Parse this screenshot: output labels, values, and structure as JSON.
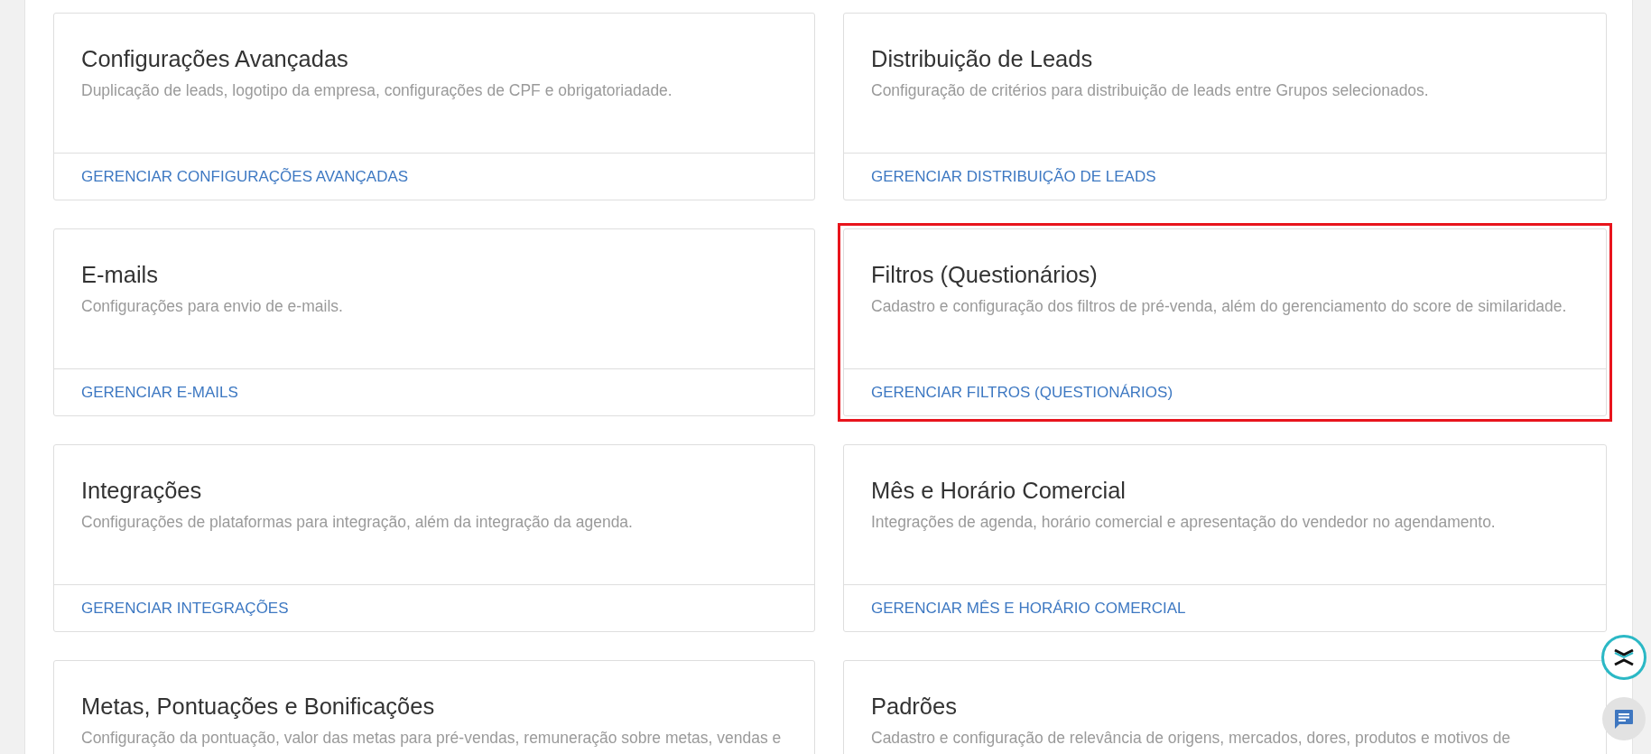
{
  "cards": [
    {
      "title": "Configurações Avançadas",
      "description": "Duplicação de leads, logotipo da empresa, configurações de CPF e obrigatoriadade.",
      "link": "GERENCIAR CONFIGURAÇÕES AVANÇADAS",
      "highlighted": false
    },
    {
      "title": "Distribuição de Leads",
      "description": "Configuração de critérios para distribuição de leads entre Grupos selecionados.",
      "link": "GERENCIAR DISTRIBUIÇÃO DE LEADS",
      "highlighted": false
    },
    {
      "title": "E-mails",
      "description": "Configurações para envio de e-mails.",
      "link": "GERENCIAR E-MAILS",
      "highlighted": false
    },
    {
      "title": "Filtros (Questionários)",
      "description": "Cadastro e configuração dos filtros de pré-venda, além do gerenciamento do score de similaridade.",
      "link": "GERENCIAR FILTROS (QUESTIONÁRIOS)",
      "highlighted": true
    },
    {
      "title": "Integrações",
      "description": "Configurações de plataformas para integração, além da integração da agenda.",
      "link": "GERENCIAR INTEGRAÇÕES",
      "highlighted": false
    },
    {
      "title": "Mês e Horário Comercial",
      "description": "Integrações de agenda, horário comercial e apresentação do vendedor no agendamento.",
      "link": "GERENCIAR MÊS E HORÁRIO COMERCIAL",
      "highlighted": false
    },
    {
      "title": "Metas, Pontuações e Bonificações",
      "description": "Configuração da pontuação, valor das metas para pré-vendas, remuneração sobre metas, vendas e",
      "highlighted": false
    },
    {
      "title": "Padrões",
      "description": "Cadastro e configuração de relevância de origens, mercados, dores, produtos e motivos de",
      "highlighted": false
    }
  ]
}
